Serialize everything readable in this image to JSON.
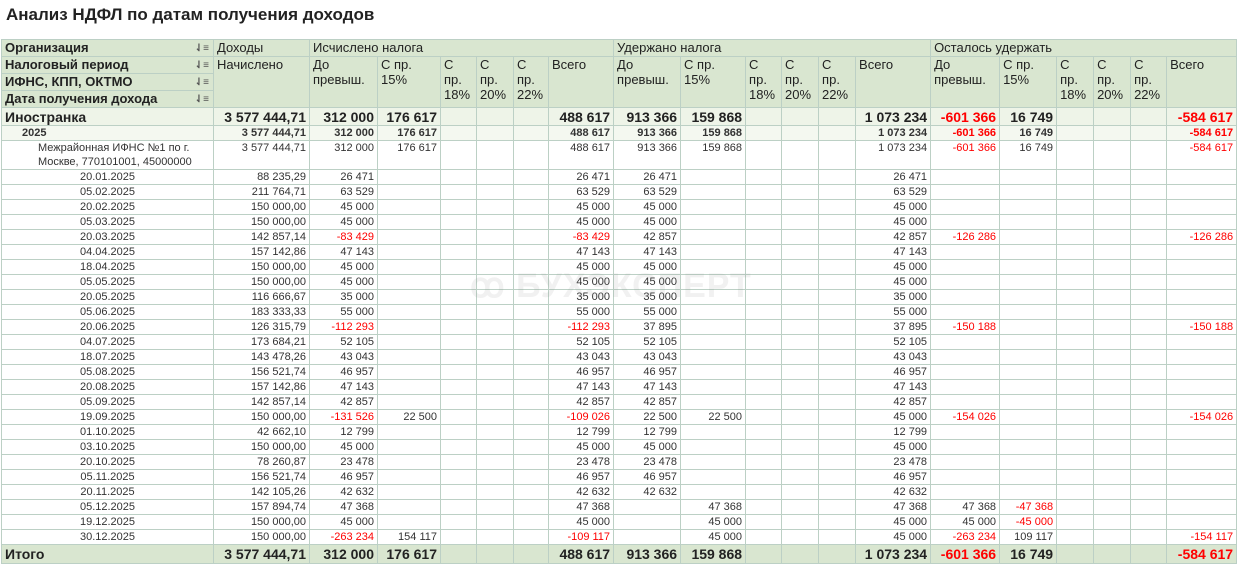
{
  "title": "Анализ НДФЛ по датам получения доходов",
  "watermark": "БУХЭКСПЕРТ",
  "row_headers": [
    "Организация",
    "Налоговый период",
    "ИФНС, КПП, ОКТМО",
    "Дата получения дохода"
  ],
  "groups": {
    "income": "Доходы",
    "calculated": "Исчислено налога",
    "withheld": "Удержано налога",
    "remaining": "Осталось удержать"
  },
  "sub_income": "Начислено",
  "sub_cols": [
    "До превыш.",
    "С пр. 15%",
    "С пр. 18%",
    "С пр. 20%",
    "С пр. 22%",
    "Всего"
  ],
  "org": {
    "name": "Иностранка",
    "v": [
      "3 577 444,71",
      "312 000",
      "176 617",
      "",
      "",
      "",
      "488 617",
      "913 366",
      "159 868",
      "",
      "",
      "",
      "1 073 234",
      "-601 366",
      "16 749",
      "",
      "",
      "",
      "-584 617"
    ]
  },
  "period": {
    "name": "2025",
    "v": [
      "3 577 444,71",
      "312 000",
      "176 617",
      "",
      "",
      "",
      "488 617",
      "913 366",
      "159 868",
      "",
      "",
      "",
      "1 073 234",
      "-601 366",
      "16 749",
      "",
      "",
      "",
      "-584 617"
    ]
  },
  "ifns": {
    "name": "Межрайонная ИФНС №1 по г. Москве, 770101001, 45000000",
    "v": [
      "3 577 444,71",
      "312 000",
      "176 617",
      "",
      "",
      "",
      "488 617",
      "913 366",
      "159 868",
      "",
      "",
      "",
      "1 073 234",
      "-601 366",
      "16 749",
      "",
      "",
      "",
      "-584 617"
    ]
  },
  "rows": [
    {
      "date": "20.01.2025",
      "v": [
        "88 235,29",
        "26 471",
        "",
        "",
        "",
        "",
        "26 471",
        "26 471",
        "",
        "",
        "",
        "",
        "26 471",
        "",
        "",
        "",
        "",
        "",
        ""
      ]
    },
    {
      "date": "05.02.2025",
      "v": [
        "211 764,71",
        "63 529",
        "",
        "",
        "",
        "",
        "63 529",
        "63 529",
        "",
        "",
        "",
        "",
        "63 529",
        "",
        "",
        "",
        "",
        "",
        ""
      ]
    },
    {
      "date": "20.02.2025",
      "v": [
        "150 000,00",
        "45 000",
        "",
        "",
        "",
        "",
        "45 000",
        "45 000",
        "",
        "",
        "",
        "",
        "45 000",
        "",
        "",
        "",
        "",
        "",
        ""
      ]
    },
    {
      "date": "05.03.2025",
      "v": [
        "150 000,00",
        "45 000",
        "",
        "",
        "",
        "",
        "45 000",
        "45 000",
        "",
        "",
        "",
        "",
        "45 000",
        "",
        "",
        "",
        "",
        "",
        ""
      ]
    },
    {
      "date": "20.03.2025",
      "v": [
        "142 857,14",
        "-83 429",
        "",
        "",
        "",
        "",
        "-83 429",
        "42 857",
        "",
        "",
        "",
        "",
        "42 857",
        "-126 286",
        "",
        "",
        "",
        "",
        "-126 286"
      ]
    },
    {
      "date": "04.04.2025",
      "v": [
        "157 142,86",
        "47 143",
        "",
        "",
        "",
        "",
        "47 143",
        "47 143",
        "",
        "",
        "",
        "",
        "47 143",
        "",
        "",
        "",
        "",
        "",
        ""
      ]
    },
    {
      "date": "18.04.2025",
      "v": [
        "150 000,00",
        "45 000",
        "",
        "",
        "",
        "",
        "45 000",
        "45 000",
        "",
        "",
        "",
        "",
        "45 000",
        "",
        "",
        "",
        "",
        "",
        ""
      ]
    },
    {
      "date": "05.05.2025",
      "v": [
        "150 000,00",
        "45 000",
        "",
        "",
        "",
        "",
        "45 000",
        "45 000",
        "",
        "",
        "",
        "",
        "45 000",
        "",
        "",
        "",
        "",
        "",
        ""
      ]
    },
    {
      "date": "20.05.2025",
      "v": [
        "116 666,67",
        "35 000",
        "",
        "",
        "",
        "",
        "35 000",
        "35 000",
        "",
        "",
        "",
        "",
        "35 000",
        "",
        "",
        "",
        "",
        "",
        ""
      ]
    },
    {
      "date": "05.06.2025",
      "v": [
        "183 333,33",
        "55 000",
        "",
        "",
        "",
        "",
        "55 000",
        "55 000",
        "",
        "",
        "",
        "",
        "55 000",
        "",
        "",
        "",
        "",
        "",
        ""
      ]
    },
    {
      "date": "20.06.2025",
      "v": [
        "126 315,79",
        "-112 293",
        "",
        "",
        "",
        "",
        "-112 293",
        "37 895",
        "",
        "",
        "",
        "",
        "37 895",
        "-150 188",
        "",
        "",
        "",
        "",
        "-150 188"
      ]
    },
    {
      "date": "04.07.2025",
      "v": [
        "173 684,21",
        "52 105",
        "",
        "",
        "",
        "",
        "52 105",
        "52 105",
        "",
        "",
        "",
        "",
        "52 105",
        "",
        "",
        "",
        "",
        "",
        ""
      ]
    },
    {
      "date": "18.07.2025",
      "v": [
        "143 478,26",
        "43 043",
        "",
        "",
        "",
        "",
        "43 043",
        "43 043",
        "",
        "",
        "",
        "",
        "43 043",
        "",
        "",
        "",
        "",
        "",
        ""
      ]
    },
    {
      "date": "05.08.2025",
      "v": [
        "156 521,74",
        "46 957",
        "",
        "",
        "",
        "",
        "46 957",
        "46 957",
        "",
        "",
        "",
        "",
        "46 957",
        "",
        "",
        "",
        "",
        "",
        ""
      ]
    },
    {
      "date": "20.08.2025",
      "v": [
        "157 142,86",
        "47 143",
        "",
        "",
        "",
        "",
        "47 143",
        "47 143",
        "",
        "",
        "",
        "",
        "47 143",
        "",
        "",
        "",
        "",
        "",
        ""
      ]
    },
    {
      "date": "05.09.2025",
      "v": [
        "142 857,14",
        "42 857",
        "",
        "",
        "",
        "",
        "42 857",
        "42 857",
        "",
        "",
        "",
        "",
        "42 857",
        "",
        "",
        "",
        "",
        "",
        ""
      ]
    },
    {
      "date": "19.09.2025",
      "v": [
        "150 000,00",
        "-131 526",
        "22 500",
        "",
        "",
        "",
        "-109 026",
        "22 500",
        "22 500",
        "",
        "",
        "",
        "45 000",
        "-154 026",
        "",
        "",
        "",
        "",
        "-154 026"
      ]
    },
    {
      "date": "01.10.2025",
      "v": [
        "42 662,10",
        "12 799",
        "",
        "",
        "",
        "",
        "12 799",
        "12 799",
        "",
        "",
        "",
        "",
        "12 799",
        "",
        "",
        "",
        "",
        "",
        ""
      ]
    },
    {
      "date": "03.10.2025",
      "v": [
        "150 000,00",
        "45 000",
        "",
        "",
        "",
        "",
        "45 000",
        "45 000",
        "",
        "",
        "",
        "",
        "45 000",
        "",
        "",
        "",
        "",
        "",
        ""
      ]
    },
    {
      "date": "20.10.2025",
      "v": [
        "78 260,87",
        "23 478",
        "",
        "",
        "",
        "",
        "23 478",
        "23 478",
        "",
        "",
        "",
        "",
        "23 478",
        "",
        "",
        "",
        "",
        "",
        ""
      ]
    },
    {
      "date": "05.11.2025",
      "v": [
        "156 521,74",
        "46 957",
        "",
        "",
        "",
        "",
        "46 957",
        "46 957",
        "",
        "",
        "",
        "",
        "46 957",
        "",
        "",
        "",
        "",
        "",
        ""
      ]
    },
    {
      "date": "20.11.2025",
      "v": [
        "142 105,26",
        "42 632",
        "",
        "",
        "",
        "",
        "42 632",
        "42 632",
        "",
        "",
        "",
        "",
        "42 632",
        "",
        "",
        "",
        "",
        "",
        ""
      ]
    },
    {
      "date": "05.12.2025",
      "v": [
        "157 894,74",
        "47 368",
        "",
        "",
        "",
        "",
        "47 368",
        "",
        "47 368",
        "",
        "",
        "",
        "47 368",
        "47 368",
        "-47 368",
        "",
        "",
        "",
        ""
      ]
    },
    {
      "date": "19.12.2025",
      "v": [
        "150 000,00",
        "45 000",
        "",
        "",
        "",
        "",
        "45 000",
        "",
        "45 000",
        "",
        "",
        "",
        "45 000",
        "45 000",
        "-45 000",
        "",
        "",
        "",
        ""
      ]
    },
    {
      "date": "30.12.2025",
      "v": [
        "150 000,00",
        "-263 234",
        "154 117",
        "",
        "",
        "",
        "-109 117",
        "",
        "45 000",
        "",
        "",
        "",
        "45 000",
        "-263 234",
        "109 117",
        "",
        "",
        "",
        "-154 117"
      ]
    }
  ],
  "total": {
    "name": "Итого",
    "v": [
      "3 577 444,71",
      "312 000",
      "176 617",
      "",
      "",
      "",
      "488 617",
      "913 366",
      "159 868",
      "",
      "",
      "",
      "1 073 234",
      "-601 366",
      "16 749",
      "",
      "",
      "",
      "-584 617"
    ]
  },
  "colors": {
    "negative": "#ff0000",
    "header_bg": "#d9e6d0",
    "grid": "#bcd0c5",
    "highlight": "#e83030"
  }
}
